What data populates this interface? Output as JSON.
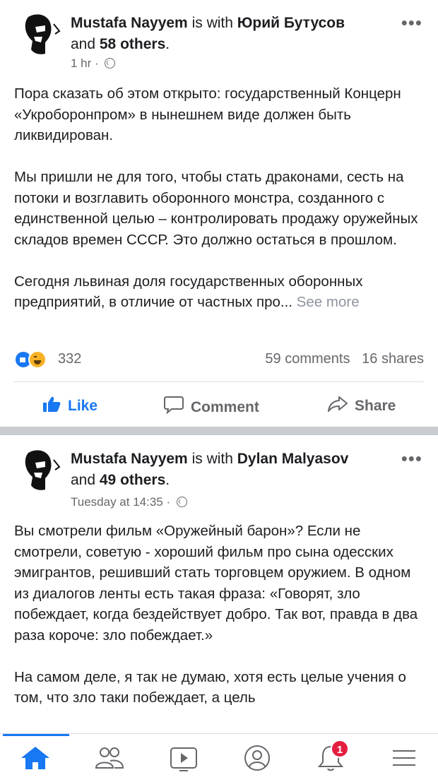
{
  "posts": [
    {
      "author": "Mustafa Nayyem",
      "with_word": " is with ",
      "tagged": "Юрий Бутусов",
      "and_word": "and ",
      "others": "58 others",
      "period": ".",
      "time": "1 hr",
      "dot": " · ",
      "paragraphs": [
        "Пора сказать об этом открыто: государственный Концерн «Укроборонпром» в нынешнем виде должен быть ликвидирован.",
        "Мы пришли не для того, чтобы стать драконами, сесть на потоки и возглавить оборонного монстра, созданного с единственной целью – контролировать продажу оружейных складов времен СССР. Это должно остаться в прошлом.",
        "Сегодня львиная доля государственных оборонных предприятий, в отличие от частных про..."
      ],
      "see_more": "See more",
      "reaction_count": "332",
      "comments": "59 comments",
      "shares": "16 shares"
    },
    {
      "author": "Mustafa Nayyem",
      "with_word": " is with ",
      "tagged": "Dylan Malyasov",
      "and_word": "and ",
      "others": "49 others",
      "period": ".",
      "time": "Tuesday at 14:35",
      "dot": " · ",
      "paragraphs": [
        "Вы смотрели фильм «Оружейный барон»? Если не смотрели, советую - хороший фильм про сына одесских эмигрантов, решивший стать торговцем оружием. В одном из диалогов ленты есть такая фраза: «Говорят, зло побеждает, когда бездействует добро. Так вот, правда в два раза короче: зло побеждает.»",
        "На самом деле, я так не думаю, хотя есть целые учения о том, что зло таки побеждает, а цель"
      ]
    }
  ],
  "actions": {
    "like": "Like",
    "comment": "Comment",
    "share": "Share"
  },
  "more_menu": "•••",
  "nav": {
    "items": [
      "home-icon",
      "friends-icon",
      "watch-icon",
      "profile-icon",
      "notifications-icon",
      "menu-icon"
    ],
    "notification_badge": "1"
  },
  "colors": {
    "accent": "#1877f2",
    "badge": "#e41e3f",
    "secondary_text": "#65676b"
  }
}
